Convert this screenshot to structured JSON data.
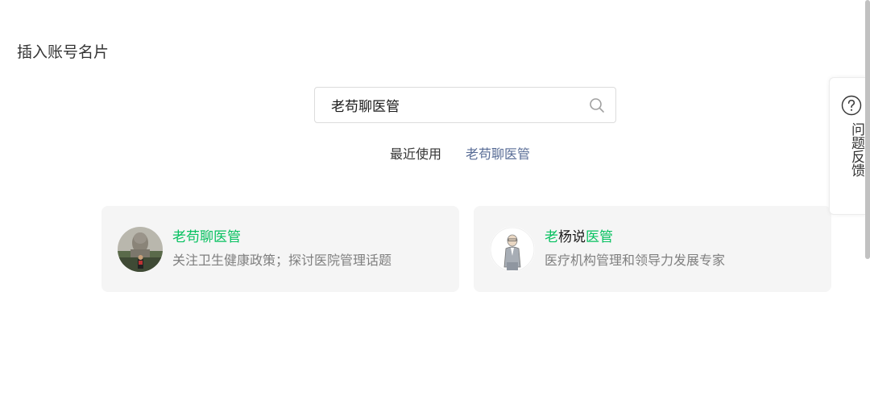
{
  "header": {
    "title": "插入账号名片"
  },
  "search": {
    "value": "老苟聊医管",
    "placeholder": ""
  },
  "recent": {
    "label": "最近使用",
    "items": [
      "老苟聊医管"
    ]
  },
  "results": [
    {
      "name_parts": [
        {
          "text": "老苟聊医管",
          "highlight": true
        }
      ],
      "description": "关注卫生健康政策；探讨医院管理话题",
      "avatar_icon": "statue-photo-avatar"
    },
    {
      "name_parts": [
        {
          "text": "老",
          "highlight": true
        },
        {
          "text": "杨说",
          "highlight": false
        },
        {
          "text": "医管",
          "highlight": true
        }
      ],
      "description": "医疗机构管理和领导力发展专家",
      "avatar_icon": "cartoon-person-avatar"
    }
  ],
  "feedback": {
    "label": "问题反馈",
    "icon": "question-circle-icon"
  },
  "colors": {
    "highlight": "#07c160",
    "link": "#576b95",
    "card_bg": "#f5f5f5",
    "text_primary": "#353535",
    "text_secondary": "#7f7f7f"
  }
}
